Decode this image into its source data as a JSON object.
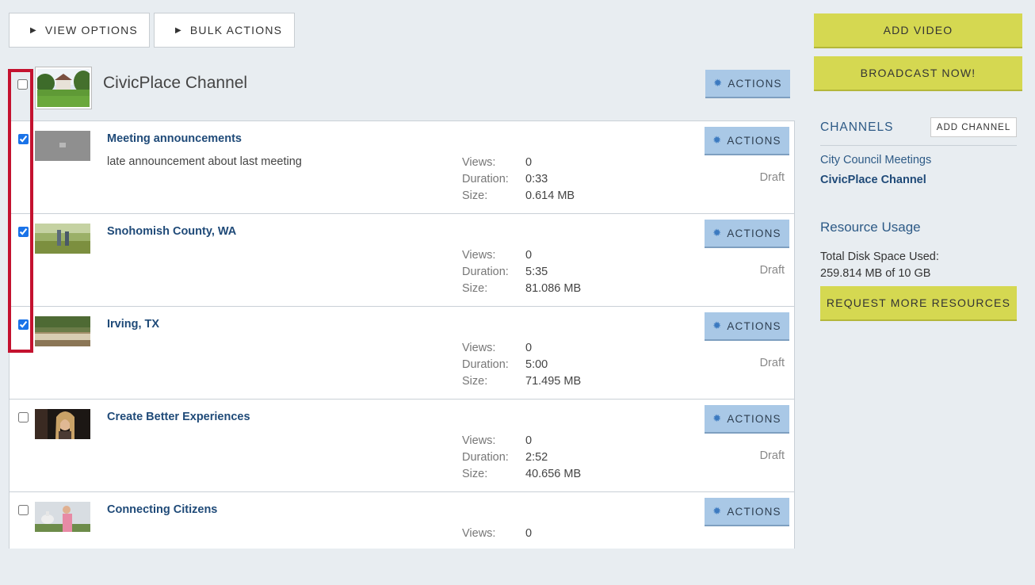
{
  "toolbar": {
    "view_options": "VIEW OPTIONS",
    "bulk_actions": "BULK ACTIONS"
  },
  "channel": {
    "title": "CivicPlace Channel",
    "actions_label": "ACTIONS",
    "checked": false
  },
  "labels": {
    "views": "Views:",
    "duration": "Duration:",
    "size": "Size:"
  },
  "videos": [
    {
      "title": "Meeting announcements",
      "description": "late announcement about last meeting",
      "views": "0",
      "duration": "0:33",
      "size": "0.614 MB",
      "status": "Draft",
      "checked": true,
      "actions_label": "ACTIONS"
    },
    {
      "title": "Snohomish County, WA",
      "description": "",
      "views": "0",
      "duration": "5:35",
      "size": "81.086 MB",
      "status": "Draft",
      "checked": true,
      "actions_label": "ACTIONS"
    },
    {
      "title": "Irving, TX",
      "description": "",
      "views": "0",
      "duration": "5:00",
      "size": "71.495 MB",
      "status": "Draft",
      "checked": true,
      "actions_label": "ACTIONS"
    },
    {
      "title": "Create Better Experiences",
      "description": "",
      "views": "0",
      "duration": "2:52",
      "size": "40.656 MB",
      "status": "Draft",
      "checked": false,
      "actions_label": "ACTIONS"
    },
    {
      "title": "Connecting Citizens",
      "description": "",
      "views": "0",
      "duration": "",
      "size": "",
      "status": "",
      "checked": false,
      "actions_label": "ACTIONS"
    }
  ],
  "sidebar": {
    "add_video": "ADD VIDEO",
    "broadcast": "BROADCAST NOW!",
    "channels_title": "CHANNELS",
    "add_channel": "ADD CHANNEL",
    "channels": [
      "City Council Meetings",
      "CivicPlace Channel"
    ],
    "resource_title": "Resource Usage",
    "disk_label": "Total Disk Space Used:",
    "disk_value": "259.814 MB of 10 GB",
    "request_resources": "REQUEST MORE RESOURCES"
  },
  "colors": {
    "accent_yellow": "#d5d851",
    "actions_blue": "#a9c8e6",
    "link_blue": "#1f4a78",
    "highlight_red": "#c4122f"
  }
}
